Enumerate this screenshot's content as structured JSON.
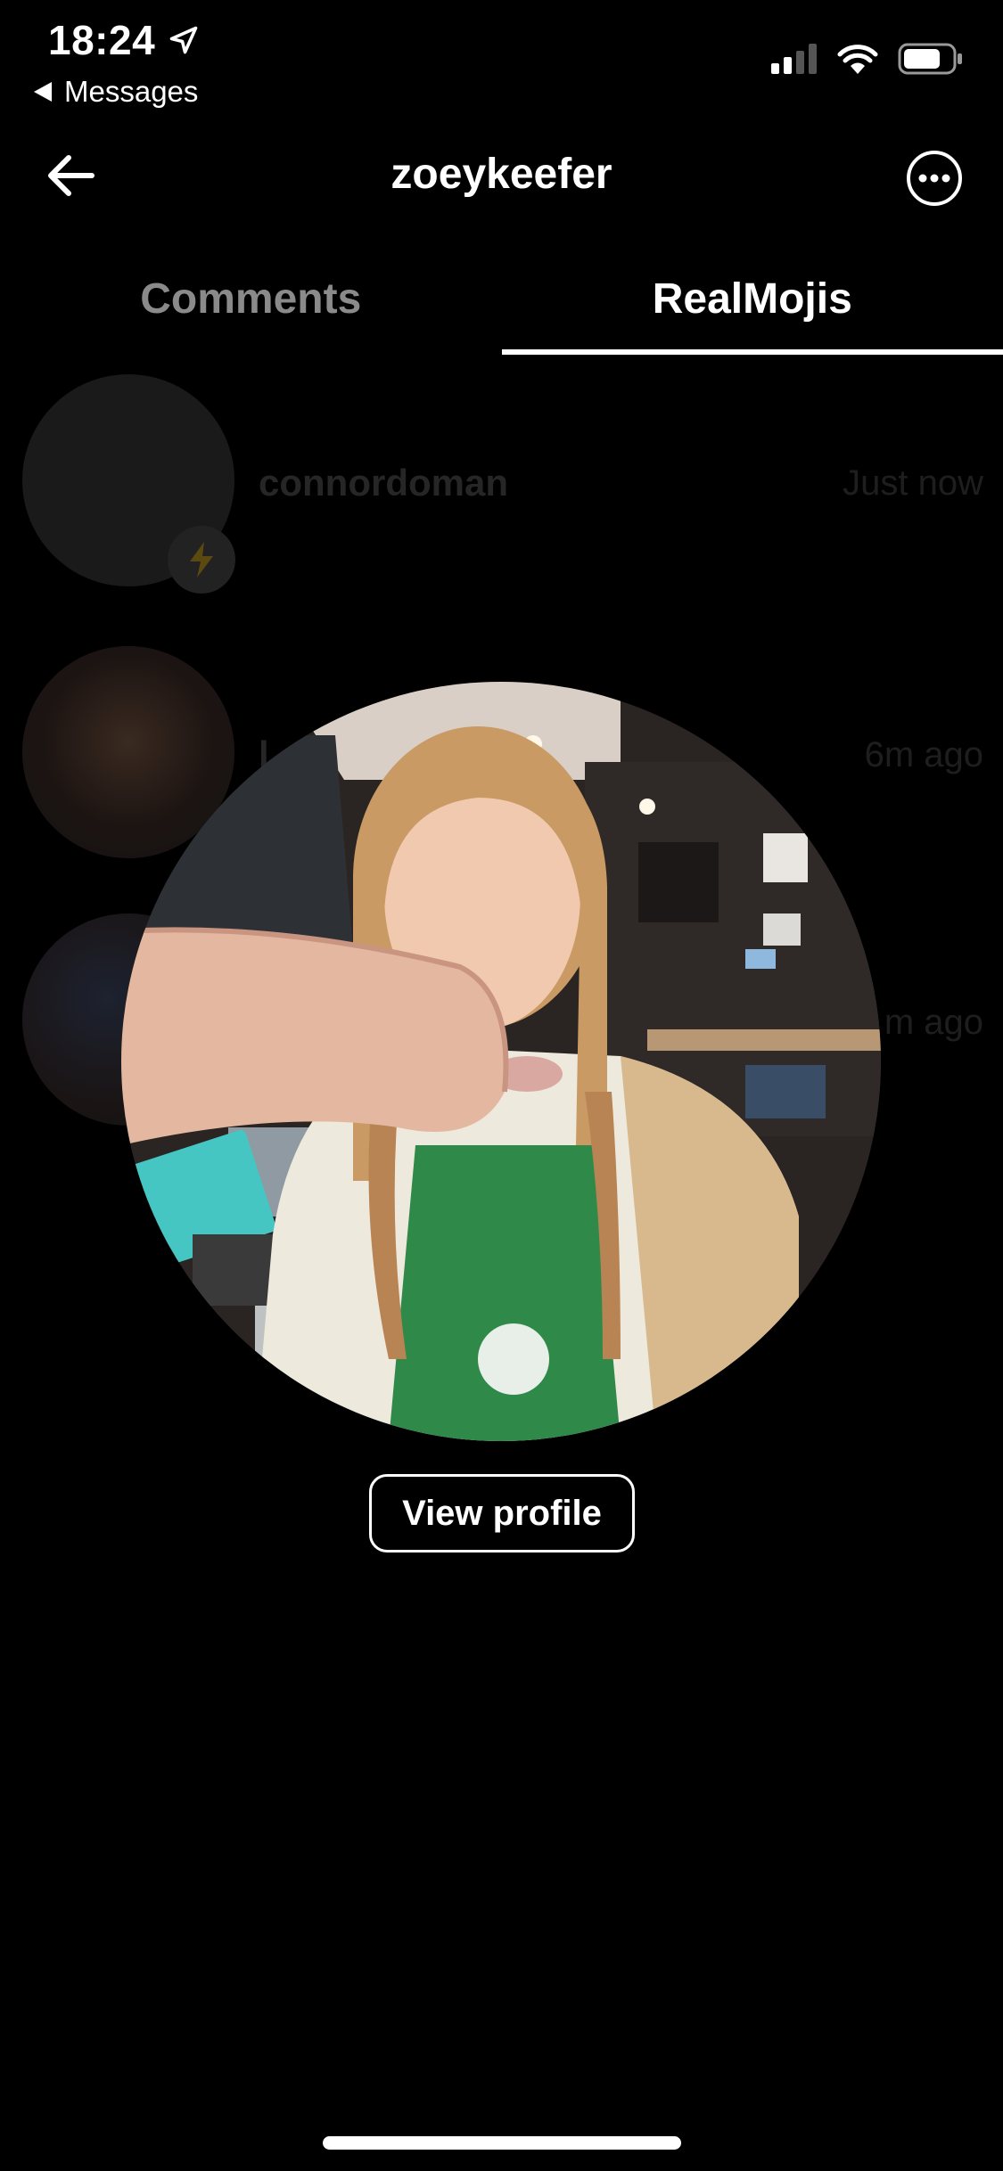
{
  "status_bar": {
    "time": "18:24",
    "back_app": "Messages"
  },
  "header": {
    "title": "zoeykeefer"
  },
  "tabs": [
    {
      "label": "Comments",
      "active": false
    },
    {
      "label": "RealMojis",
      "active": true
    }
  ],
  "list": [
    {
      "name": "connordoman",
      "time": "Just now"
    },
    {
      "name": "l",
      "time": "6m ago"
    },
    {
      "name": "",
      "time": "m ago"
    }
  ],
  "actions": {
    "view_profile": "View profile"
  },
  "colors": {
    "background": "#000000",
    "text": "#ffffff",
    "inactive_tab": "#8a8a8a",
    "badge_bolt": "#c9a400"
  }
}
